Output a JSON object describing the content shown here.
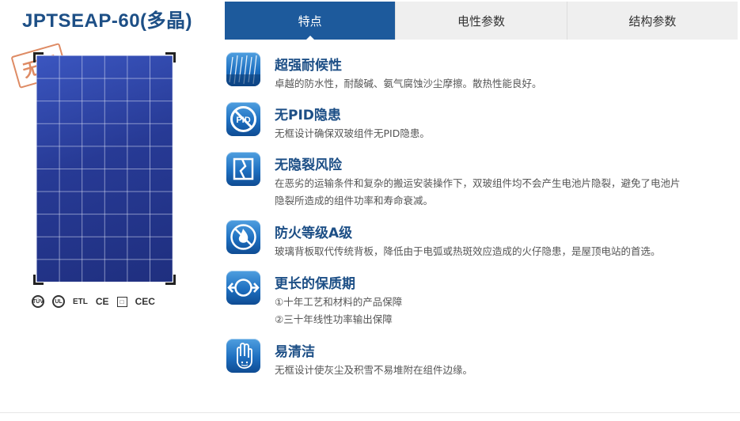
{
  "product": {
    "title": "JPTSEAP-60(多晶)",
    "stamp": "无框"
  },
  "certifications": [
    "TÜV",
    "UL",
    "ETL",
    "CE",
    "□",
    "CEC"
  ],
  "tabs": [
    {
      "label": "特点",
      "active": true
    },
    {
      "label": "电性参数",
      "active": false
    },
    {
      "label": "结构参数",
      "active": false
    }
  ],
  "features": [
    {
      "icon": "rain-icon",
      "title": "超强耐候性",
      "desc": [
        "卓越的防水性，耐酸碱、氨气腐蚀沙尘摩擦。散热性能良好。"
      ]
    },
    {
      "icon": "no-pid-icon",
      "title": "无PID隐患",
      "desc": [
        "无框设计确保双玻组件无PID隐患。"
      ]
    },
    {
      "icon": "crack-icon",
      "title": "无隐裂风险",
      "desc": [
        "在恶劣的运输条件和复杂的搬运安装操作下，双玻组件均不会产生电池片隐裂，避免了电池片",
        "隐裂所造成的组件功率和寿命衰减。"
      ]
    },
    {
      "icon": "fire-icon",
      "title": "防火等级A级",
      "desc": [
        "玻璃背板取代传统背板，降低由于电弧或热斑效应造成的火仔隐患，是屋顶电站的首选。"
      ]
    },
    {
      "icon": "warranty-icon",
      "title": "更长的保质期",
      "desc": [
        "①十年工艺和材料的产品保障",
        "②三十年线性功率输出保障"
      ]
    },
    {
      "icon": "clean-icon",
      "title": "易清洁",
      "desc": [
        "无框设计使灰尘及积雪不易堆附在组件边缘。"
      ]
    }
  ],
  "colors": {
    "accent": "#1d5a9c",
    "title": "#1d4f86"
  }
}
